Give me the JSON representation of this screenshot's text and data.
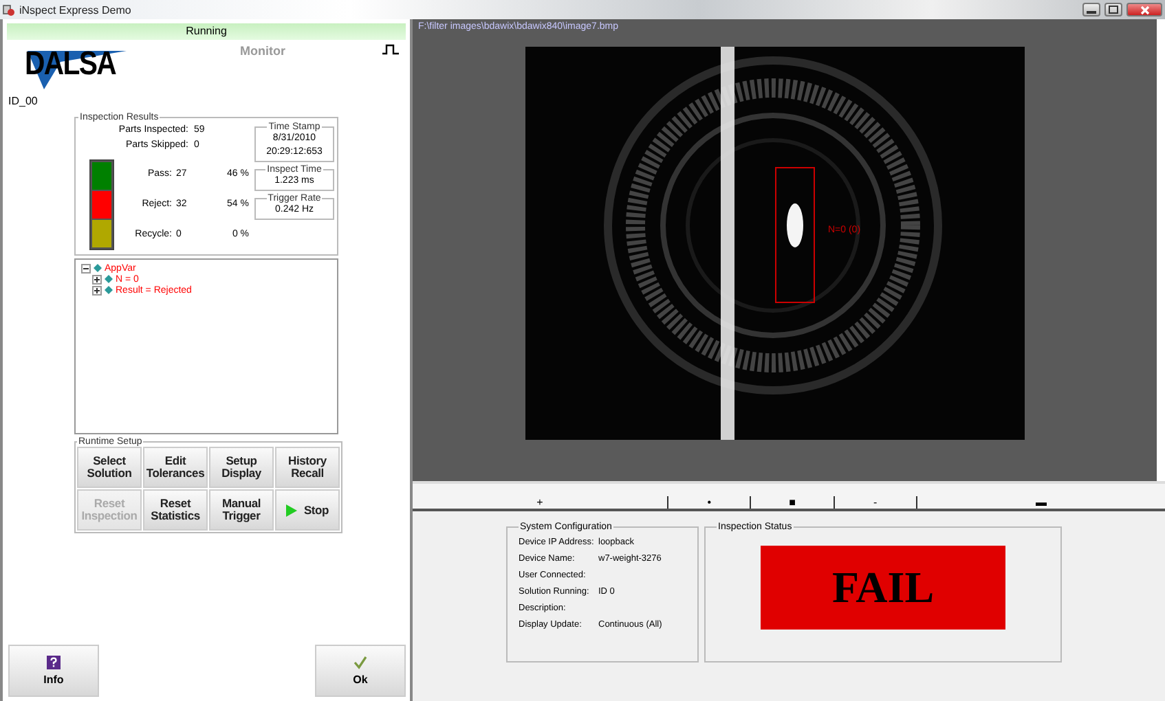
{
  "window": {
    "title": "iNspect Express Demo"
  },
  "header": {
    "status": "Running",
    "mode": "Monitor",
    "logo": "DALSA",
    "device_id": "ID_00"
  },
  "inspection_results": {
    "title": "Inspection Results",
    "counters": [
      {
        "label": "Parts Inspected:",
        "value": "59"
      },
      {
        "label": "Parts Skipped:",
        "value": "0"
      }
    ],
    "categories": [
      {
        "label": "Pass:",
        "count": "27",
        "percent": "46 %",
        "color": "#008000"
      },
      {
        "label": "Reject:",
        "count": "32",
        "percent": "54 %",
        "color": "#ff0000"
      },
      {
        "label": "Recycle:",
        "count": "0",
        "percent": "0 %",
        "color": "#b0a800"
      }
    ],
    "stats": [
      {
        "title": "Time Stamp",
        "lines": [
          "8/31/2010",
          "20:29:12:653"
        ]
      },
      {
        "title": "Inspect Time",
        "lines": [
          "1.223 ms"
        ]
      },
      {
        "title": "Trigger Rate",
        "lines": [
          "0.242 Hz"
        ]
      }
    ]
  },
  "tree": [
    {
      "label": "AppVar",
      "expanded": true,
      "children": [
        {
          "label": "N = 0",
          "expanded": false
        },
        {
          "label": "Result = Rejected",
          "expanded": false
        }
      ]
    }
  ],
  "runtime_setup": {
    "title": "Runtime Setup",
    "buttons": [
      {
        "label": "Select Solution",
        "kind": "text",
        "disabled": false
      },
      {
        "label": "Edit Tolerances",
        "kind": "text",
        "disabled": false
      },
      {
        "label": "Setup Display",
        "kind": "text",
        "disabled": false
      },
      {
        "label": "History Recall",
        "kind": "text",
        "disabled": false
      },
      {
        "label": "Reset Inspection",
        "kind": "text",
        "disabled": true
      },
      {
        "label": "Reset Statistics",
        "kind": "text",
        "disabled": false
      },
      {
        "label": "Manual Trigger",
        "kind": "text",
        "disabled": false
      },
      {
        "label": "Stop",
        "kind": "play",
        "disabled": false
      }
    ]
  },
  "footer_buttons": [
    {
      "label": "Info",
      "kind": "help"
    },
    {
      "label": "Ok",
      "kind": "check"
    }
  ],
  "image_view": {
    "path": "F:\\filter images\\bdawix\\bdawix840\\image7.bmp",
    "overlay_label": "N=0 (0)"
  },
  "ruler": {
    "marks": [
      "+",
      "•",
      "■",
      "-",
      "▬"
    ]
  },
  "system_configuration": {
    "title": "System Configuration",
    "rows": [
      {
        "label": "Device IP Address:",
        "value": "loopback"
      },
      {
        "label": "Device Name:",
        "value": "w7-weight-3276"
      },
      {
        "label": "User Connected:"
      },
      {
        "label": "Solution Running:",
        "value": "ID 0"
      },
      {
        "label": "Description:"
      },
      {
        "label": "Display Update:",
        "value": "Continuous (All)"
      }
    ]
  },
  "inspection_status": {
    "title": "Inspection Status",
    "result": "FAIL"
  }
}
